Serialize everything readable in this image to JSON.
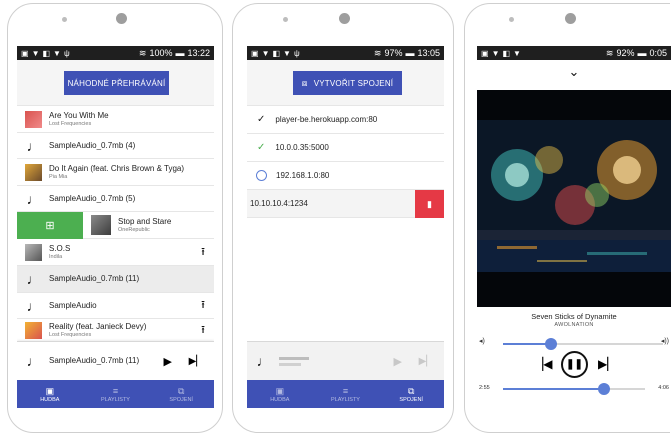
{
  "phone1": {
    "status": {
      "battery": "100%",
      "time": "13:22"
    },
    "shuffle_button": "NÁHODNÉ PŘEHRÁVÁNÍ",
    "tracks": [
      {
        "title": "Are You With Me",
        "artist": "Lost Frequencies"
      },
      {
        "title": "SampleAudio_0.7mb (4)"
      },
      {
        "title": "Do It Again (feat. Chris Brown & Tyga)",
        "artist": "Pia Mia"
      },
      {
        "title": "SampleAudio_0.7mb (5)"
      },
      {
        "title": "Stop and Stare",
        "artist": "OneRepublic"
      },
      {
        "title": "S.O.S",
        "artist": "Indila"
      },
      {
        "title": "SampleAudio_0.7mb (11)"
      },
      {
        "title": "SampleAudio"
      },
      {
        "title": "Reality (feat. Janieck Devy)",
        "artist": "Lost Frequencies"
      }
    ],
    "mini_player_title": "SampleAudio_0.7mb (11)"
  },
  "phone2": {
    "status": {
      "battery": "97%",
      "time": "13:05"
    },
    "connect_button": "VYTVOŘIT SPOJENÍ",
    "servers": [
      {
        "address": "player-be.herokuapp.com:80"
      },
      {
        "address": "10.0.0.35:5000"
      },
      {
        "address": "192.168.1.0:80"
      },
      {
        "address": "10.10.10.4:1234"
      }
    ]
  },
  "phone3": {
    "status": {
      "battery": "92%",
      "time": "0:05"
    },
    "song_title": "Seven Sticks of Dynamite",
    "artist": "AWOLNATION",
    "volume_fraction": 0.3,
    "elapsed": "2:55",
    "duration": "4:06",
    "progress_fraction": 0.71
  },
  "nav": {
    "music": "HUDBA",
    "playlists": "PLAYLISTY",
    "connections": "SPOJENÍ"
  },
  "colors": {
    "primary": "#3f51b5",
    "accent": "#5c7fd6",
    "success": "#4caf50",
    "danger": "#e53945"
  }
}
